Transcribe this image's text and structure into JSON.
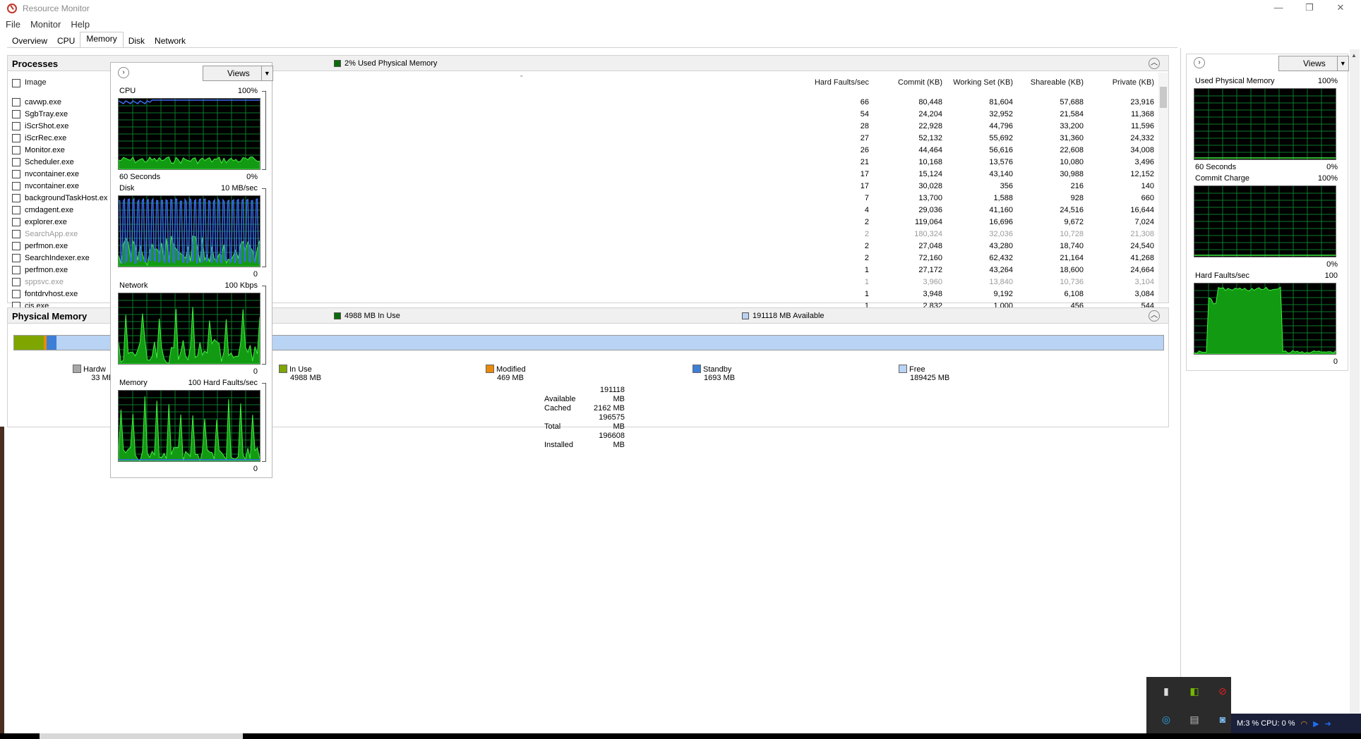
{
  "window": {
    "title": "Resource Monitor",
    "controls": {
      "minimize": "—",
      "restore": "❐",
      "close": "✕"
    }
  },
  "menu": [
    "File",
    "Monitor",
    "Help"
  ],
  "tabs": [
    "Overview",
    "CPU",
    "Memory",
    "Disk",
    "Network"
  ],
  "active_tab": "Memory",
  "processes": {
    "title": "Processes",
    "legend": "2% Used Physical Memory",
    "legend_color": "#0b6b0b",
    "columns": [
      "Image",
      "Hard Faults/sec",
      "Commit (KB)",
      "Working Set (KB)",
      "Shareable (KB)",
      "Private (KB)"
    ],
    "rows": [
      [
        "cavwp.exe",
        "66",
        "80,448",
        "81,604",
        "57,688",
        "23,916"
      ],
      [
        "SgbTray.exe",
        "54",
        "24,204",
        "32,952",
        "21,584",
        "11,368"
      ],
      [
        "iScrShot.exe",
        "28",
        "22,928",
        "44,796",
        "33,200",
        "11,596"
      ],
      [
        "iScrRec.exe",
        "27",
        "52,132",
        "55,692",
        "31,360",
        "24,332"
      ],
      [
        "Monitor.exe",
        "26",
        "44,464",
        "56,616",
        "22,608",
        "34,008"
      ],
      [
        "Scheduler.exe",
        "21",
        "10,168",
        "13,576",
        "10,080",
        "3,496"
      ],
      [
        "nvcontainer.exe",
        "17",
        "15,124",
        "43,140",
        "30,988",
        "12,152"
      ],
      [
        "nvcontainer.exe",
        "17",
        "30,028",
        "356",
        "216",
        "140"
      ],
      [
        "backgroundTaskHost.ex",
        "7",
        "13,700",
        "1,588",
        "928",
        "660"
      ],
      [
        "cmdagent.exe",
        "4",
        "29,036",
        "41,160",
        "24,516",
        "16,644"
      ],
      [
        "explorer.exe",
        "2",
        "119,064",
        "16,696",
        "9,672",
        "7,024"
      ],
      [
        "SearchApp.exe",
        "2",
        "180,324",
        "32,036",
        "10,728",
        "21,308"
      ],
      [
        "perfmon.exe",
        "2",
        "27,048",
        "43,280",
        "18,740",
        "24,540"
      ],
      [
        "SearchIndexer.exe",
        "2",
        "72,160",
        "62,432",
        "21,164",
        "41,268"
      ],
      [
        "perfmon.exe",
        "1",
        "27,172",
        "43,264",
        "18,600",
        "24,664"
      ],
      [
        "sppsvc.exe",
        "1",
        "3,960",
        "13,840",
        "10,736",
        "3,104"
      ],
      [
        "fontdrvhost.exe",
        "1",
        "3,948",
        "9,192",
        "6,108",
        "3,084"
      ],
      [
        "cis.exe",
        "1",
        "2,832",
        "1,000",
        "456",
        "544"
      ]
    ],
    "gray_rows": [
      11,
      15
    ]
  },
  "physical_memory": {
    "title": "Physical Memory",
    "in_use_legend": "4988 MB In Use",
    "available_legend": "191118 MB Available",
    "categories": [
      {
        "label": "Hardware Reserved",
        "short": "Hardw",
        "value": "33 MB",
        "color": "#a8a8a8",
        "fraction": 0.0002
      },
      {
        "label": "In Use",
        "value": "4988 MB",
        "color": "#7fa600",
        "fraction": 0.0254
      },
      {
        "label": "Modified",
        "value": "469 MB",
        "color": "#e98a0c",
        "fraction": 0.0024
      },
      {
        "label": "Standby",
        "value": "1693 MB",
        "color": "#3d7fd6",
        "fraction": 0.0086
      },
      {
        "label": "Free",
        "value": "189425 MB",
        "color": "#b8d3f3",
        "fraction": 0.9635
      }
    ],
    "summary": [
      {
        "k": "Available",
        "v": "191118 MB"
      },
      {
        "k": "Cached",
        "v": "2162 MB"
      },
      {
        "k": "Total",
        "v": "196575 MB"
      },
      {
        "k": "Installed",
        "v": "196608 MB"
      }
    ]
  },
  "popup": {
    "views_label": "Views",
    "graphs": [
      {
        "name": "CPU",
        "max": "100%",
        "footer_left": "60 Seconds",
        "footer_right": "0%"
      },
      {
        "name": "Disk",
        "max": "10 MB/sec",
        "footer_left": "",
        "footer_right": "0"
      },
      {
        "name": "Network",
        "max": "100 Kbps",
        "footer_left": "",
        "footer_right": "0"
      },
      {
        "name": "Memory",
        "max": "100 Hard Faults/sec",
        "footer_left": "",
        "footer_right": "0"
      }
    ]
  },
  "side": {
    "views_label": "Views",
    "graphs": [
      {
        "name": "Used Physical Memory",
        "max": "100%",
        "footer_left": "60 Seconds",
        "footer_right": "0%"
      },
      {
        "name": "Commit Charge",
        "max": "100%",
        "footer_left": "",
        "footer_right": "0%"
      },
      {
        "name": "Hard Faults/sec",
        "max": "100",
        "footer_left": "",
        "footer_right": "0"
      }
    ]
  },
  "tray": {
    "status": "M:3 %   CPU: 0 %"
  },
  "icons": [
    "resource-monitor-icon",
    "chevron-right-icon",
    "chevron-up-icon",
    "dropdown-arrow-icon",
    "usb-icon",
    "nvidia-icon",
    "antivirus-icon",
    "cortana-icon",
    "gpu-icon",
    "camera-icon",
    "wifi-icon",
    "video-icon",
    "arrow-icon"
  ]
}
